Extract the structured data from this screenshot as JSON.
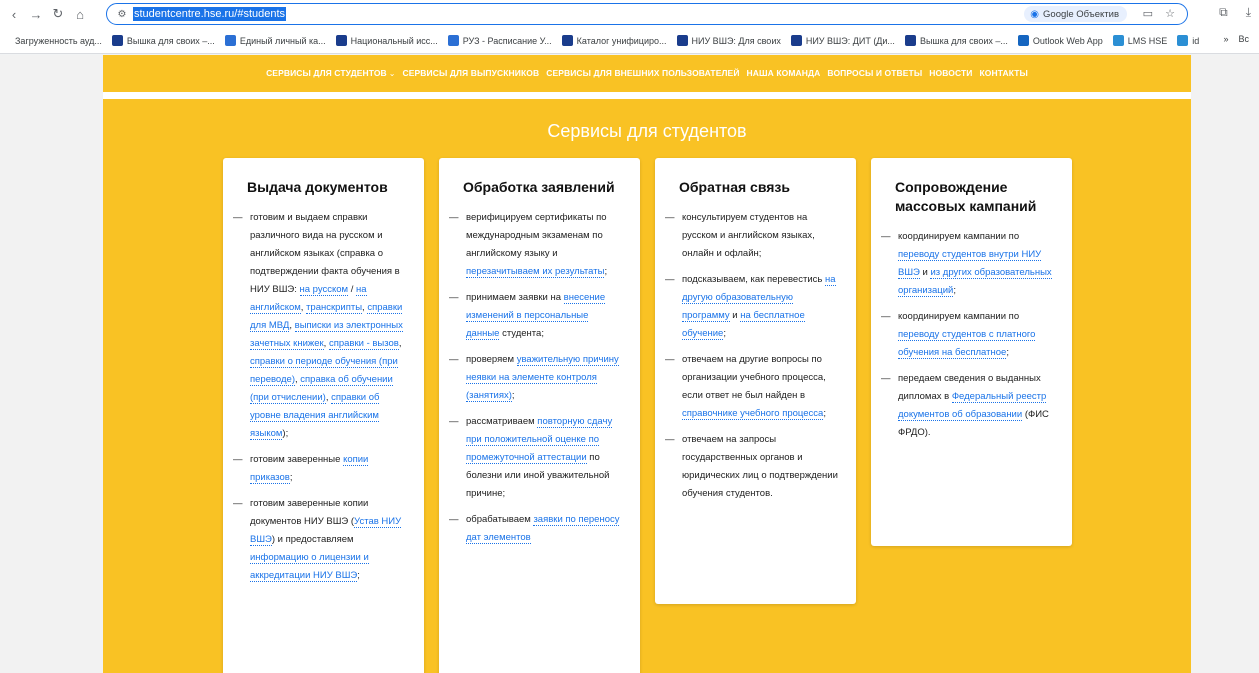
{
  "browser": {
    "url": "studentcentre.hse.ru/#students",
    "lens_label": "Google Объектив",
    "bookmarks": [
      {
        "label": "Загруженность ауд...",
        "color": "#ffffff"
      },
      {
        "label": "Вышка для своих –...",
        "color": "#1a3c8c"
      },
      {
        "label": "Единый личный ка...",
        "color": "#2b6fd4"
      },
      {
        "label": "Национальный исс...",
        "color": "#1a3c8c"
      },
      {
        "label": "РУЗ - Расписание У...",
        "color": "#2b6fd4"
      },
      {
        "label": "Каталог унифициро...",
        "color": "#1a3c8c"
      },
      {
        "label": "НИУ ВШЭ: Для своих",
        "color": "#1a3c8c"
      },
      {
        "label": "НИУ ВШЭ: ДИТ (Ди...",
        "color": "#1a3c8c"
      },
      {
        "label": "Вышка для своих –...",
        "color": "#1a3c8c"
      },
      {
        "label": "Outlook Web App",
        "color": "#1565c0"
      },
      {
        "label": "LMS HSE",
        "color": "#2b8fd4"
      },
      {
        "label": "id",
        "color": "#2b8fd4"
      }
    ],
    "bookmarks_more": "»",
    "all_bookmarks": "Вс"
  },
  "nav": {
    "items": [
      "СЕРВИСЫ ДЛЯ СТУДЕНТОВ",
      "СЕРВИСЫ ДЛЯ ВЫПУСКНИКОВ",
      "СЕРВИСЫ ДЛЯ ВНЕШНИХ ПОЛЬЗОВАТЕЛЕЙ",
      "НАША КОМАНДА",
      "ВОПРОСЫ И ОТВЕТЫ",
      "НОВОСТИ",
      "КОНТАКТЫ"
    ]
  },
  "section_title": "Сервисы для студентов",
  "cards": [
    {
      "title": "Выдача документов",
      "items": [
        [
          {
            "t": "готовим и выдаем справки различного вида на русском и английском языках (справка о подтверждении факта обучения в НИУ ВШЭ: "
          },
          {
            "t": "на русском",
            "link": true
          },
          {
            "t": " / "
          },
          {
            "t": "на английском",
            "link": true
          },
          {
            "t": ", "
          },
          {
            "t": "транскрипты",
            "link": true
          },
          {
            "t": ", "
          },
          {
            "t": "справки для МВД",
            "link": true
          },
          {
            "t": ", "
          },
          {
            "t": "выписки из электронных зачетных книжек",
            "link": true
          },
          {
            "t": ", "
          },
          {
            "t": "справки - вызов",
            "link": true
          },
          {
            "t": ", "
          },
          {
            "t": "справки о периоде обучения (при переводе)",
            "link": true
          },
          {
            "t": ", "
          },
          {
            "t": "справка об обучении (при отчислении)",
            "link": true
          },
          {
            "t": ", "
          },
          {
            "t": "справки об уровне владения английским языком",
            "link": true
          },
          {
            "t": ");"
          }
        ],
        [
          {
            "t": "готовим заверенные "
          },
          {
            "t": "копии приказов",
            "link": true
          },
          {
            "t": ";"
          }
        ],
        [
          {
            "t": "готовим заверенные копии документов НИУ ВШЭ ("
          },
          {
            "t": "Устав НИУ ВШЭ",
            "link": true
          },
          {
            "t": ") и предоставляем "
          },
          {
            "t": "информацию о лицензии и аккредитации НИУ ВШЭ",
            "link": true
          },
          {
            "t": ";"
          }
        ]
      ]
    },
    {
      "title": "Обработка заявлений",
      "items": [
        [
          {
            "t": "верифицируем сертификаты по международным экзаменам по английскому языку и "
          },
          {
            "t": "перезачитываем их результаты",
            "link": true
          },
          {
            "t": ";"
          }
        ],
        [
          {
            "t": "принимаем заявки на "
          },
          {
            "t": "внесение изменений в персональные данные",
            "link": true
          },
          {
            "t": " студента;"
          }
        ],
        [
          {
            "t": "проверяем "
          },
          {
            "t": "уважительную причину неявки на элементе контроля (занятиях)",
            "link": true
          },
          {
            "t": ";"
          }
        ],
        [
          {
            "t": "рассматриваем "
          },
          {
            "t": "повторную сдачу при положительной оценке по промежуточной аттестации",
            "link": true
          },
          {
            "t": " по болезни или иной уважительной причине;"
          }
        ],
        [
          {
            "t": "обрабатываем "
          },
          {
            "t": "заявки по переносу дат элементов",
            "link": true
          }
        ]
      ]
    },
    {
      "title": "Обратная связь",
      "items": [
        [
          {
            "t": "консультируем студентов на русском и английском языках, онлайн и офлайн;"
          }
        ],
        [
          {
            "t": "подсказываем, как перевестись "
          },
          {
            "t": "на другую образовательную программу",
            "link": true
          },
          {
            "t": " и "
          },
          {
            "t": "на бесплатное обучение",
            "link": true
          },
          {
            "t": ";"
          }
        ],
        [
          {
            "t": "отвечаем на другие вопросы по организации учебного процесса, если ответ не был найден в "
          },
          {
            "t": "справочнике учебного процесса",
            "link": true
          },
          {
            "t": ";"
          }
        ],
        [
          {
            "t": "отвечаем на запросы государственных органов и юридических лиц о подтверждении обучения студентов."
          }
        ]
      ]
    },
    {
      "title": "Сопровождение массовых кампаний",
      "items": [
        [
          {
            "t": "координируем кампании по "
          },
          {
            "t": "переводу студентов внутри НИУ ВШЭ",
            "link": true
          },
          {
            "t": " и "
          },
          {
            "t": "из других образовательных организаций",
            "link": true
          },
          {
            "t": ";"
          }
        ],
        [
          {
            "t": "координируем кампании по "
          },
          {
            "t": "переводу студентов с платного обучения на бесплатное",
            "link": true
          },
          {
            "t": ";"
          }
        ],
        [
          {
            "t": "передаем сведения о выданных дипломах в "
          },
          {
            "t": "Федеральный реестр документов об образовании",
            "link": true
          },
          {
            "t": " (ФИС ФРДО)."
          }
        ]
      ]
    }
  ]
}
